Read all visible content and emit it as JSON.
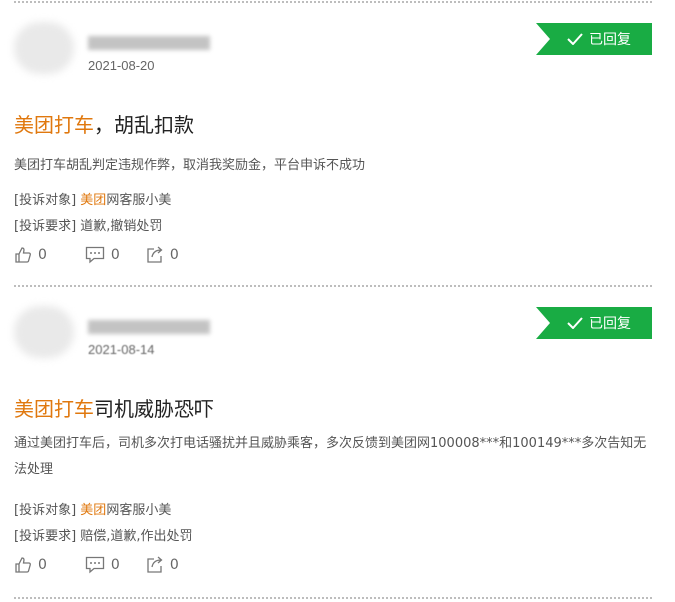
{
  "posts": [
    {
      "date": "2021-08-20",
      "status": "已回复",
      "title_brand": "美团打车",
      "title_rest": "，胡乱扣款",
      "content": "美团打车胡乱判定违规作弊，取消我奖励金，平台申诉不成功",
      "target_label": "[投诉对象]",
      "target_brand": "美团",
      "target_rest": "网客服小美",
      "demand_label": "[投诉要求]",
      "demand": "道歉,撤销处罚",
      "likes": "0",
      "comments": "0",
      "shares": "0"
    },
    {
      "date": "2021-08-14",
      "status": "已回复",
      "title_brand": "美团打车",
      "title_rest": "司机威胁恐吓",
      "content": "通过美团打车后，司机多次打电话骚扰并且威胁乘客，多次反馈到美团网100008***和100149***多次告知无法处理",
      "target_label": "[投诉对象]",
      "target_brand": "美团",
      "target_rest": "网客服小美",
      "demand_label": "[投诉要求]",
      "demand": "赔偿,道歉,作出处罚",
      "likes": "0",
      "comments": "0",
      "shares": "0"
    }
  ],
  "colors": {
    "accent": "#19ac44",
    "brand": "#e0780e"
  },
  "icons": [
    "check-icon",
    "thumbs-up-icon",
    "comment-icon",
    "share-icon"
  ]
}
